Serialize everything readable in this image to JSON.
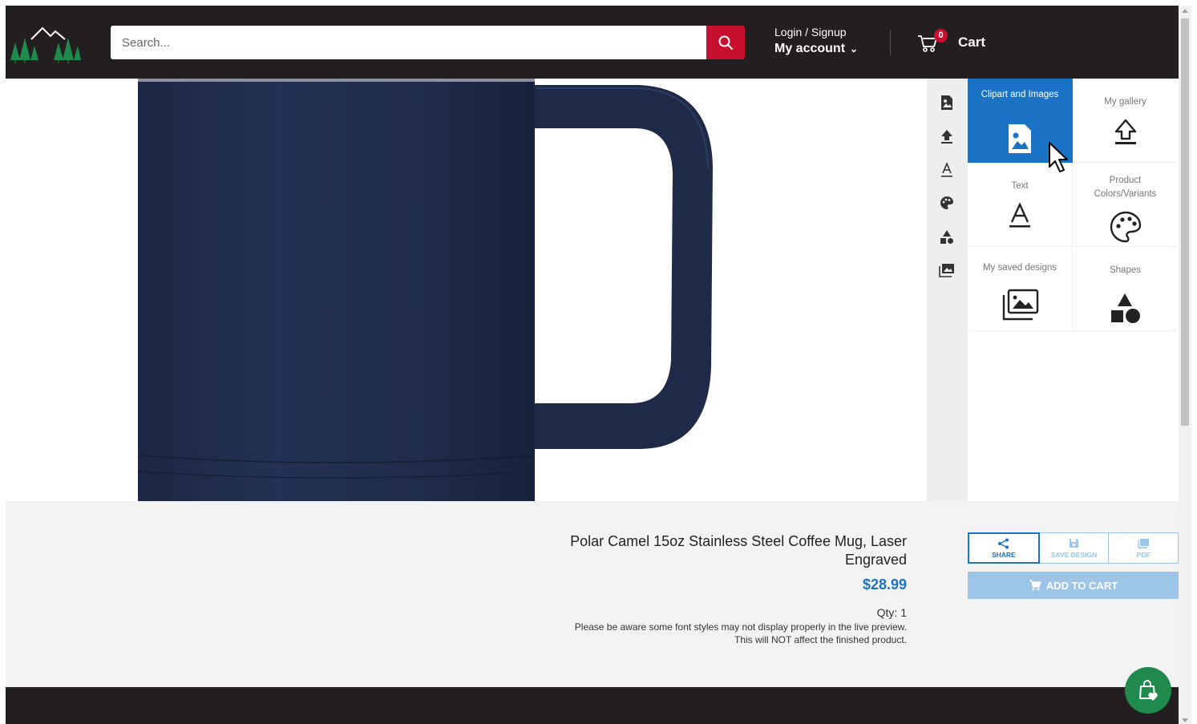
{
  "header": {
    "search_placeholder": "Search...",
    "login_label": "Login / Signup",
    "account_label": "My account",
    "cart_count": "0",
    "cart_label": "Cart"
  },
  "tools": {
    "icons": [
      "clipart-icon",
      "upload-icon",
      "text-icon",
      "palette-icon",
      "shapes-icon",
      "gallery-icon"
    ]
  },
  "panel": {
    "tiles": [
      {
        "label": "Clipart and Images",
        "icon": "clipart-icon",
        "active": true
      },
      {
        "label": "My gallery",
        "icon": "upload-icon"
      },
      {
        "label": "Text",
        "icon": "text-icon"
      },
      {
        "label": "Product Colors/Variants",
        "icon": "palette-icon"
      },
      {
        "label": "My saved designs",
        "icon": "saved-designs-icon"
      },
      {
        "label": "Shapes",
        "icon": "shapes-icon"
      }
    ]
  },
  "product": {
    "title": "Polar Camel 15oz Stainless Steel Coffee Mug, Laser Engraved",
    "price": "$28.99",
    "qty": "Qty: 1",
    "note_line1": "Please be aware some font styles may not display properly in the live preview.",
    "note_line2": "This will NOT affect the finished product."
  },
  "actions": {
    "share_label": "SHARE",
    "save_label": "SAVE DESIGN",
    "pdf_label": "PDF",
    "add_to_cart_label": "ADD TO CART"
  },
  "colors": {
    "header_bg": "#231f20",
    "accent_red": "#c8102e",
    "accent_blue": "#1a73c4",
    "mug_navy": "#1e2a47",
    "fab_green": "#1f8a4c"
  }
}
